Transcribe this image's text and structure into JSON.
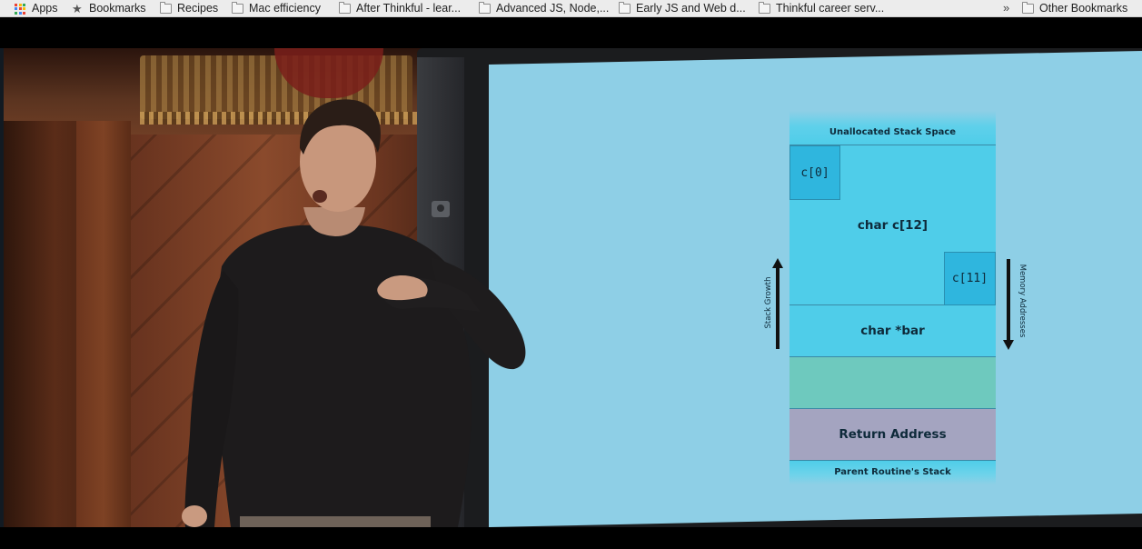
{
  "bookmarks_bar": {
    "items": [
      {
        "label": "Apps",
        "icon": "apps-grid-icon"
      },
      {
        "label": "Bookmarks",
        "icon": "star-icon"
      },
      {
        "label": "Recipes",
        "icon": "folder-icon"
      },
      {
        "label": "Mac efficiency",
        "icon": "folder-icon"
      },
      {
        "label": "After Thinkful - lear...",
        "icon": "folder-icon"
      },
      {
        "label": "Advanced JS, Node,...",
        "icon": "folder-icon"
      },
      {
        "label": "Early JS and Web d...",
        "icon": "folder-icon"
      },
      {
        "label": "Thinkful career serv...",
        "icon": "folder-icon"
      }
    ],
    "overflow_label": "»",
    "other_bookmarks": "Other Bookmarks"
  },
  "slide": {
    "cells": {
      "unallocated": "Unallocated Stack Space",
      "char_array": "char c[12]",
      "c0": "c[0]",
      "c11": "c[11]",
      "char_ptr": "char *bar",
      "return_address": "Return Address",
      "parent_stack": "Parent Routine's Stack"
    },
    "stack_growth_label": "Stack Growth",
    "memory_addresses_label": "Memory Addresses"
  },
  "colors": {
    "slide_background": "#8ecfe6",
    "stack_cell": "#4fcde9",
    "array_element": "#2fb6de",
    "green_cell": "#6ec9be",
    "return_cell": "#a4a4c0"
  }
}
